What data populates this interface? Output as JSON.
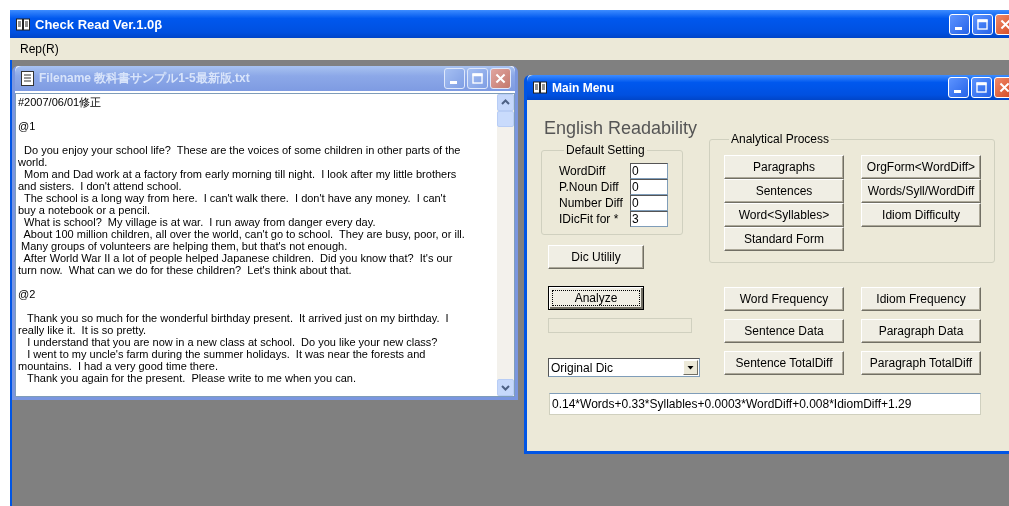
{
  "app": {
    "title": "Check Read Ver.1.0β",
    "menu": [
      {
        "label": "Rep(R)"
      }
    ]
  },
  "document_window": {
    "title": "Filename 教科書サンプル1-5最新版.txt",
    "active": false,
    "blocks": [
      [
        "#2007/06/01修正"
      ],
      [
        "@1"
      ],
      [
        "  Do you enjoy your school life?  These are the voices of some children in other parts of the",
        "world.",
        "  Mom and Dad work at a factory from early morning till night.  I look after my little brothers",
        "and sisters.  I don't attend school.",
        "  The school is a long way from here.  I can't walk there.  I don't have any money.  I can't",
        "buy a notebook or a pencil.",
        "  What is school?  My village is at war.  I run away from danger every day.",
        "  About 100 million children, all over the world, can't go to school.  They are busy, poor, or ill.",
        " Many groups of volunteers are helping them, but that's not enough.",
        "  After World War II a lot of people helped Japanese children.  Did you know that?  It's our",
        "turn now.  What can we do for these children?  Let's think about that."
      ],
      [
        "@2"
      ],
      [
        "   Thank you so much for the wonderful birthday present.  It arrived just on my birthday.  I",
        "really like it.  It is so pretty.",
        "   I understand that you are now in a new class at school.  Do you like your new class?",
        "   I went to my uncle's farm during the summer holidays.  It was near the forests and",
        "mountains.  I had a very good time there.",
        "   Thank you again for the present.  Please write to me when you can."
      ]
    ]
  },
  "main_menu": {
    "title": "Main Menu",
    "active": true,
    "heading": "English Readability",
    "default_setting": {
      "label": "Default Setting",
      "fields": [
        {
          "label": "WordDiff",
          "value": "0"
        },
        {
          "label": "P.Noun Diff",
          "value": "0"
        },
        {
          "label": "Number Diff",
          "value": "0"
        },
        {
          "label": "IDicFit for *",
          "value": "3"
        }
      ]
    },
    "analytical_process": {
      "label": "Analytical Process",
      "buttons": [
        {
          "label": "Paragraphs"
        },
        {
          "label": "OrgForm<WordDiff>"
        },
        {
          "label": "Sentences"
        },
        {
          "label": "Words/Syll/WordDiff"
        },
        {
          "label": "Word<Syllables>"
        },
        {
          "label": "Idiom Difficulty"
        },
        {
          "label": "Standard Form"
        }
      ]
    },
    "dic_button": {
      "label": "Dic Utilily",
      "focused": false
    },
    "analyze_button": {
      "label": "Analyze",
      "focused": true
    },
    "result_buttons": [
      {
        "label": "Word Frequency"
      },
      {
        "label": "Idiom Frequency"
      },
      {
        "label": "Sentence Data"
      },
      {
        "label": "Paragraph Data"
      },
      {
        "label": "Sentence TotalDiff"
      },
      {
        "label": "Paragraph TotalDiff"
      }
    ],
    "dictionary_select": {
      "value": "Original Dic"
    },
    "formula": {
      "value": "0.14*Words+0.33*Syllables+0.0003*WordDiff+0.008*IdiomDiff+1.29"
    }
  }
}
